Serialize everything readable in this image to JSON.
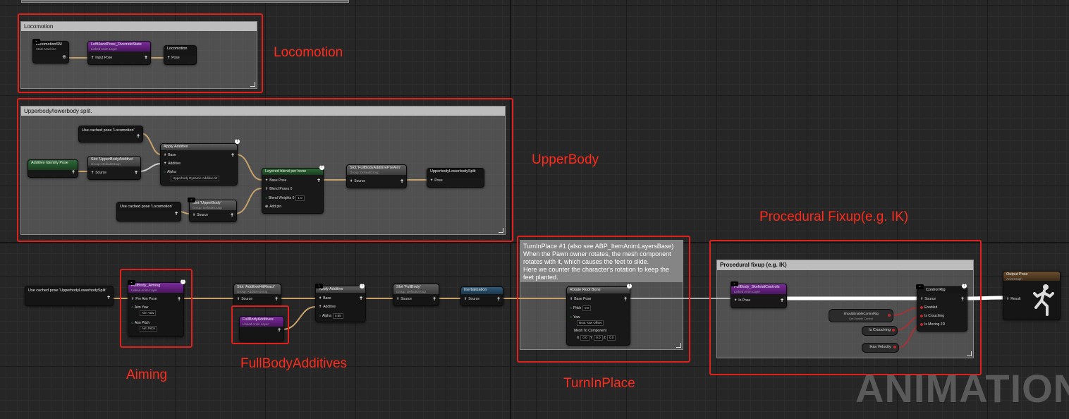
{
  "comments": {
    "locomotion": "Locomotion",
    "upperbody": "Upperbody/lowerbody split.",
    "turninplace": "TurnInPlace #1 (also see ABP_ItemAnimLayersBase)\nWhen the Pawn owner rotates, the mesh component rotates with it, which causes the feet to slide.\nHere we counter the character's rotation to keep the feet planted.",
    "procedural": "Procedural fixup (e.g. IK)"
  },
  "annotations": {
    "locomotion": "Locomotion",
    "upperbody": "UpperBody",
    "procedural": "Procedural Fixup(e.g. IK)",
    "aiming": "Aiming",
    "fullbody": "FullBodyAdditives",
    "turninplace": "TurnInPlace"
  },
  "nodes": {
    "locomotion_sm": {
      "title": "LocomotionSM",
      "sub": "State Machine"
    },
    "lefthand": {
      "title": "LeftHandPose_OverrideState",
      "sub": "Linked Anim Layer",
      "pin": "Input Pose"
    },
    "locomotion_save": {
      "title": "Locomotion",
      "pin": "Pose"
    },
    "cached_loco1": {
      "title": "Use cached pose 'Locomotion'"
    },
    "additive_identity": {
      "title": "Additive Identity Pose"
    },
    "slot_upper_add": {
      "title": "Slot 'UpperBodyAdditive'",
      "sub": "Group: DefaultGroup",
      "pin": "Source"
    },
    "apply_additive": {
      "title": "Apply Additive",
      "base": "Base",
      "additive": "Additive",
      "alpha": "Alpha",
      "curve": "Upperbody Dynamic Additive W"
    },
    "layered_blend": {
      "title": "Layered blend per bone",
      "base": "Base Pose",
      "poses": "Blend Poses 0",
      "weights": "Blend Weights 0",
      "weights_value": "1.0",
      "add": "Add pin"
    },
    "slot_fullbody_prealign": {
      "title": "Slot 'FullBodyAdditivePreAim'",
      "sub": "Group: DefaultGroup",
      "pin": "Source"
    },
    "upper_lower_save": {
      "title": "UpperbodyLowerbodySplit",
      "pin": "Pose"
    },
    "cached_loco2": {
      "title": "Use cached pose 'Locomotion'"
    },
    "slot_upperbody": {
      "title": "Slot 'UpperBody'",
      "sub": "Group: DefaultGroup",
      "pin": "Source"
    },
    "cached_split": {
      "title": "Use cached pose 'UpperbodyLowerbodySplit'"
    },
    "aiming": {
      "title": "FullBody_Aiming",
      "sub": "Linked Anim Layer",
      "pin": "Pre Aim Pose",
      "yaw": "Aim Yaw",
      "yaw_val": "Aim Yaw",
      "pitch": "Aim Pitch",
      "pitch_val": "Aim Pitch"
    },
    "slot_additivehitreact": {
      "title": "Slot 'AdditiveHitReact'",
      "sub": "Group: AdditiveGroup",
      "pin": "Source"
    },
    "fullbody_additives": {
      "title": "FullBodyAdditives",
      "sub": "Linked Anim Layer"
    },
    "apply_additive2": {
      "title": "Apply Additive",
      "base": "Base",
      "additive": "Additive",
      "alpha": "Alpha",
      "alpha_value": "0.65"
    },
    "slot_fullbody": {
      "title": "Slot 'FullBody'",
      "sub": "Group: DefaultGroup",
      "pin": "Source"
    },
    "inertialization": {
      "title": "Inertialization",
      "pin": "Source"
    },
    "rotate_root": {
      "title": "Rotate Root Bone",
      "base": "Base Pose",
      "pitch": "Pitch",
      "pitch_val": "0.0",
      "yaw": "Yaw",
      "yaw_val": "Root Yaw Offset",
      "mtc": "Mesh To Component",
      "x": "X",
      "y": "Y",
      "z": "Z",
      "v0": "0.0"
    },
    "skeletal_controls": {
      "title": "FullBody_SkeletalControls",
      "sub": "Linked Anim Layer",
      "pin": "In Pose"
    },
    "control_rig": {
      "title": "Control Rig",
      "source": "Source",
      "enabled": "Enabled",
      "crouch": "Is Crouching",
      "moving": "Is Moving 2D"
    },
    "should_enable": {
      "title": "ShouldEnableControlRig",
      "sub": "Get Enable Control"
    },
    "is_crouching": {
      "title": "Is Crouching"
    },
    "has_velocity": {
      "title": "Has Velocity"
    },
    "output_pose": {
      "title": "Output Pose",
      "sub": "AnimGraph",
      "pin": "Result"
    }
  },
  "watermark": "ANIMATION",
  "colors": {
    "annotation": "#ff2b1c",
    "wire": "#c7a16a",
    "exec_wire": "#ffffff",
    "bool_pin": "#c0282e"
  }
}
